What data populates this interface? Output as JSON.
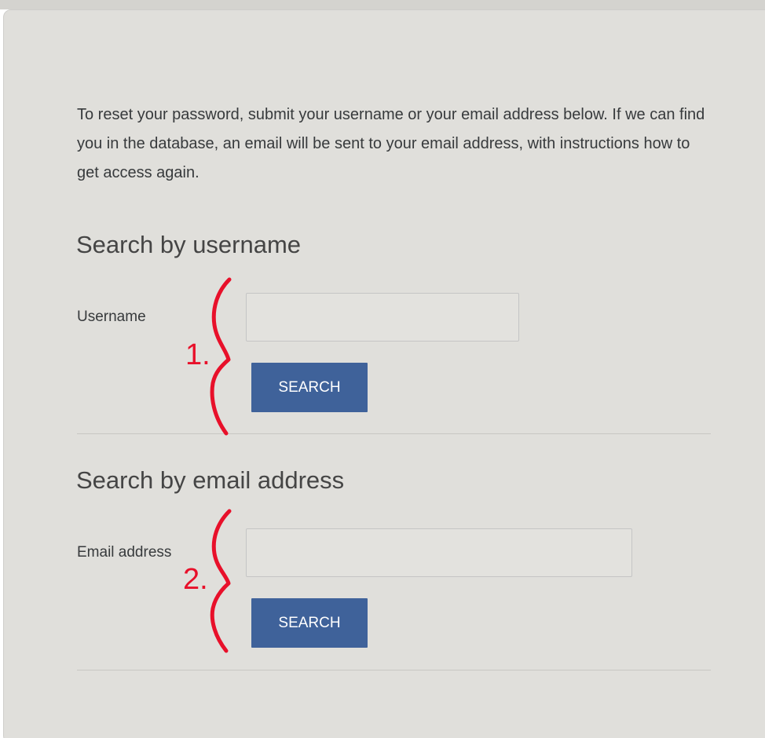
{
  "intro_text": "To reset your password, submit your username or your email address below. If we can find you in the database, an email will be sent to your email address, with instructions how to get access again.",
  "username_section": {
    "heading": "Search by username",
    "field_label": "Username",
    "field_value": "",
    "button_label": "SEARCH"
  },
  "email_section": {
    "heading": "Search by email address",
    "field_label": "Email address",
    "field_value": "",
    "button_label": "SEARCH"
  },
  "annotations": {
    "first_label": "1.",
    "second_label": "2.",
    "color": "#e8102a"
  },
  "colors": {
    "button_background": "#3f629a",
    "card_background": "#e0dfdb"
  }
}
